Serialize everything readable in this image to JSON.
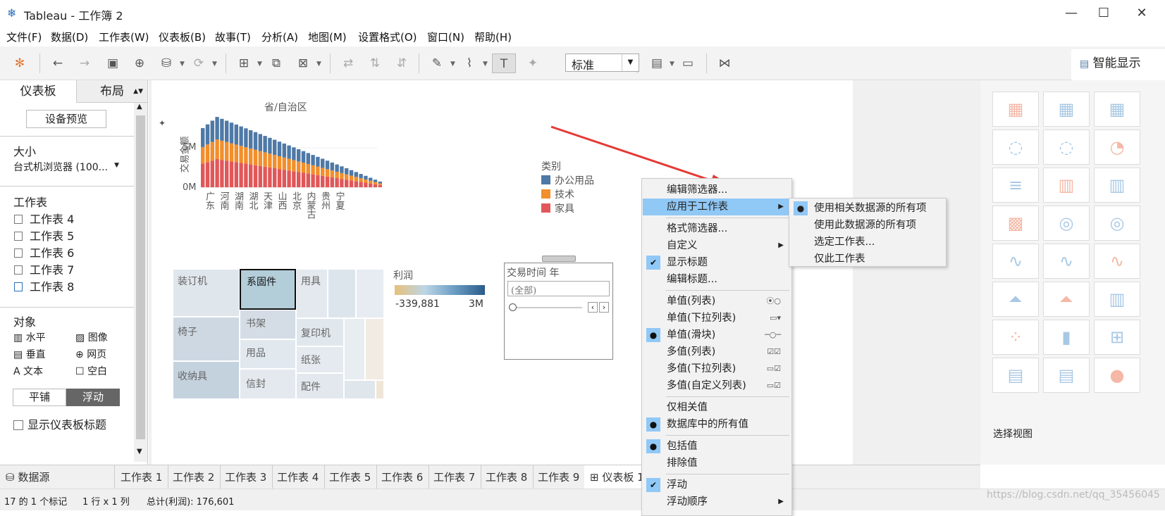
{
  "window": {
    "title": "Tableau - 工作簿 2"
  },
  "menu": [
    "文件(F)",
    "数据(D)",
    "工作表(W)",
    "仪表板(B)",
    "故事(T)",
    "分析(A)",
    "地图(M)",
    "设置格式(O)",
    "窗口(N)",
    "帮助(H)"
  ],
  "toolbar": {
    "zoom_value": "标准"
  },
  "smart_show": {
    "label": "智能显示",
    "footer": "选择视图"
  },
  "left_panel": {
    "tab_dashboard": "仪表板",
    "tab_layout": "布局",
    "device_preview": "设备预览",
    "size_heading": "大小",
    "size_value": "台式机浏览器 (100...",
    "worksheets_heading": "工作表",
    "worksheets": [
      "工作表 4",
      "工作表 5",
      "工作表 6",
      "工作表 7",
      "工作表 8"
    ],
    "objects_heading": "对象",
    "objects": [
      "水平",
      "图像",
      "垂直",
      "网页",
      "文本",
      "空白"
    ],
    "tile_button": "平铺",
    "float_button": "浮动",
    "show_title": "显示仪表板标题"
  },
  "chart": {
    "title": "省/自治区",
    "ylabel": "交易金额",
    "ytick_5m": "5M",
    "ytick_0m": "0M",
    "xlabels": [
      "广东",
      "河南",
      "湖南",
      "湖北",
      "天津",
      "山西",
      "北京",
      "内蒙古",
      "贵州",
      "宁夏"
    ],
    "legend_title": "类别",
    "legend": [
      {
        "name": "办公用品",
        "color": "#4e79a7"
      },
      {
        "name": "技术",
        "color": "#f28e2b"
      },
      {
        "name": "家具",
        "color": "#e15759"
      }
    ]
  },
  "treemap": {
    "labels": [
      "装订机",
      "系固件",
      "用具",
      "椅子",
      "书架",
      "复印机",
      "用品",
      "纸张",
      "收纳具",
      "信封",
      "配件"
    ]
  },
  "profit_legend": {
    "title": "利润",
    "min": "-339,881",
    "max": "3M"
  },
  "filter": {
    "title": "交易时间 年",
    "value": "(全部)"
  },
  "context_menu": {
    "edit_filter": "编辑筛选器...",
    "apply_to": "应用于工作表",
    "format_filter": "格式筛选器...",
    "customize": "自定义",
    "show_title": "显示标题",
    "edit_title": "编辑标题...",
    "single_list": "单值(列表)",
    "single_dropdown": "单值(下拉列表)",
    "single_slider": "单值(滑块)",
    "multi_list": "多值(列表)",
    "multi_dropdown": "多值(下拉列表)",
    "multi_custom": "多值(自定义列表)",
    "relevant_only": "仅相关值",
    "all_db_values": "数据库中的所有值",
    "include_values": "包括值",
    "exclude_values": "排除值",
    "floating": "浮动",
    "float_order": "浮动顺序"
  },
  "submenu": [
    "使用相关数据源的所有项",
    "使用此数据源的所有项",
    "选定工作表...",
    "仅此工作表"
  ],
  "sheet_tabs": [
    "数据源",
    "工作表 1",
    "工作表 2",
    "工作表 3",
    "工作表 4",
    "工作表 5",
    "工作表 6",
    "工作表 7",
    "工作表 8",
    "工作表 9",
    "仪表板 1"
  ],
  "status": {
    "marks": "17 的 1 个标记",
    "rows": "1 行 x 1 列",
    "total": "总计(利润): 176,601"
  },
  "watermark": "https://blog.csdn.net/qq_35456045"
}
